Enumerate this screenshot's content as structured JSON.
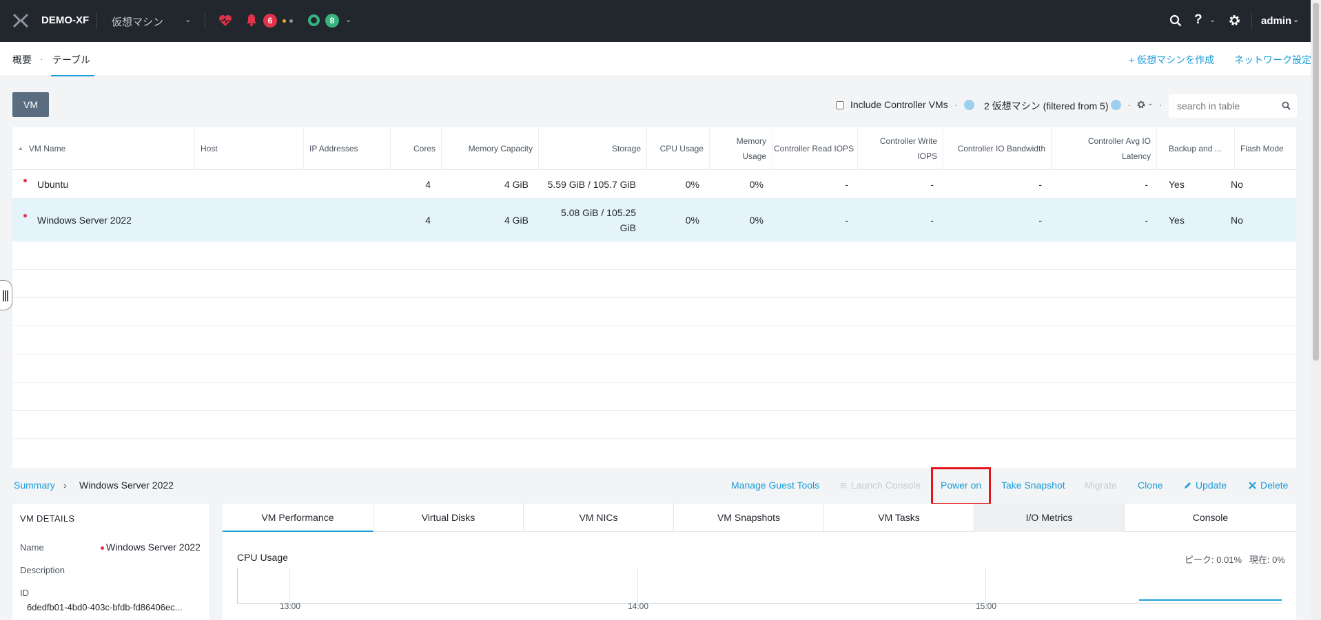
{
  "topbar": {
    "cluster_name": "DEMO-XF",
    "menu_label": "仮想マシン",
    "alert_count": "6",
    "task_count": "8",
    "user_label": "admin"
  },
  "subnav": {
    "tab_overview": "概要",
    "tab_separator": "·",
    "tab_table": "テーブル",
    "create_vm": "+ 仮想マシンを作成",
    "network_config": "ネットワーク設定"
  },
  "toolbar": {
    "vm_button": "VM",
    "include_controller_vms": "Include Controller VMs",
    "dot_sep": "·",
    "count_text": "2 仮想マシン (filtered from 5)",
    "search_placeholder": "search in table"
  },
  "table": {
    "columns": [
      "VM Name",
      "Host",
      "IP Addresses",
      "Cores",
      "Memory Capacity",
      "Storage",
      "CPU Usage",
      "Memory Usage",
      "Controller Read IOPS",
      "Controller Write IOPS",
      "Controller IO Bandwidth",
      "Controller Avg IO Latency",
      "Backup and ...",
      "Flash Mode"
    ],
    "rows": [
      {
        "name": "Ubuntu",
        "host": "",
        "ip": "",
        "cores": "4",
        "memory": "4 GiB",
        "storage": "5.59 GiB / 105.7 GiB",
        "cpu": "0%",
        "mem_usage": "0%",
        "read_iops": "-",
        "write_iops": "-",
        "io_bw": "-",
        "io_lat": "-",
        "backup": "Yes",
        "flash": "No"
      },
      {
        "name": "Windows Server 2022",
        "host": "",
        "ip": "",
        "cores": "4",
        "memory": "4 GiB",
        "storage": "5.08 GiB / 105.25 GiB",
        "cpu": "0%",
        "mem_usage": "0%",
        "read_iops": "-",
        "write_iops": "-",
        "io_bw": "-",
        "io_lat": "-",
        "backup": "Yes",
        "flash": "No"
      }
    ]
  },
  "detail_bar": {
    "summary": "Summary",
    "chevron": "›",
    "selected_vm": "Windows Server 2022",
    "actions": {
      "manage_guest_tools": "Manage Guest Tools",
      "launch_console": "Launch Console",
      "power_on": "Power on",
      "take_snapshot": "Take Snapshot",
      "migrate": "Migrate",
      "clone": "Clone",
      "update": "Update",
      "delete": "Delete"
    }
  },
  "vm_details": {
    "title": "VM DETAILS",
    "name_label": "Name",
    "name_value": "Windows Server 2022",
    "description_label": "Description",
    "id_label": "ID",
    "id_value": "6dedfb01-4bd0-403c-bfdb-fd86406ec..."
  },
  "perf": {
    "tabs": [
      "VM Performance",
      "Virtual Disks",
      "VM NICs",
      "VM Snapshots",
      "VM Tasks",
      "I/O Metrics",
      "Console"
    ],
    "chart_title": "CPU Usage",
    "peak_text": "ピーク: 0.01%   現在: 0%",
    "ticks": [
      "13:00",
      "14:00",
      "15:00"
    ]
  },
  "colors": {
    "topbar_bg": "#22272e",
    "accent": "#1b9cd9",
    "alert_red": "#e0334b",
    "ok_green": "#36b37e",
    "selected_row": "#e5f3fb",
    "highlight": "#e3151a"
  }
}
